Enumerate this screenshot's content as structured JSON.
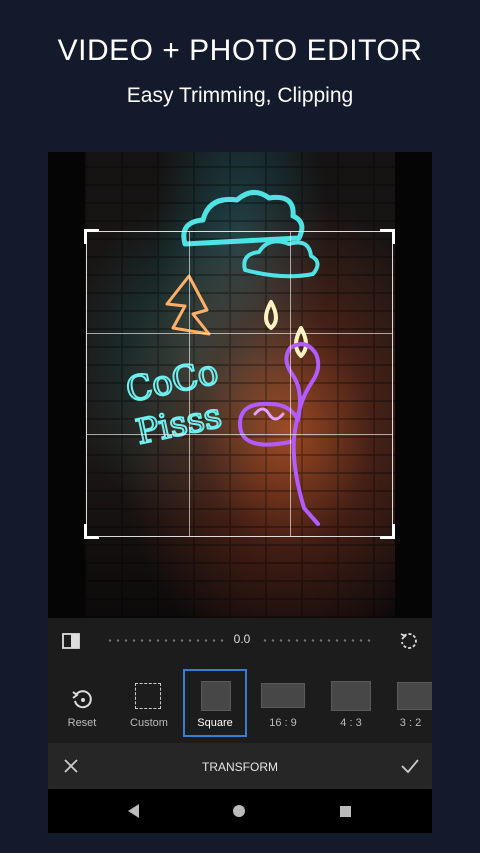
{
  "promo": {
    "title": "VIDEO + PHOTO EDITOR",
    "subtitle": "Easy Trimming, Clipping"
  },
  "photo": {
    "neon_text_line1": "CoCo",
    "neon_text_line2": "Pisss"
  },
  "rotation": {
    "value": "0.0",
    "flip_icon": "flip-horizontal-icon",
    "reset_icon": "rotate-reset-icon"
  },
  "aspect_options": [
    {
      "label": "Reset",
      "icon": "reset-icon",
      "selected": false
    },
    {
      "label": "Custom",
      "icon": "custom-crop-icon",
      "selected": false
    },
    {
      "label": "Square",
      "icon": "square-ratio-icon",
      "selected": true
    },
    {
      "label": "16 : 9",
      "icon": "ratio-16-9-icon",
      "selected": false
    },
    {
      "label": "4 : 3",
      "icon": "ratio-4-3-icon",
      "selected": false
    },
    {
      "label": "3 : 2",
      "icon": "ratio-3-2-icon",
      "selected": false
    }
  ],
  "action_bar": {
    "title": "TRANSFORM",
    "close_icon": "close-icon",
    "confirm_icon": "check-icon"
  },
  "colors": {
    "background": "#131a2b",
    "selection_accent": "#3a7bd5",
    "neon_cyan": "#4fe3e6",
    "neon_purple": "#b25bff",
    "neon_orange": "#ffb066"
  }
}
